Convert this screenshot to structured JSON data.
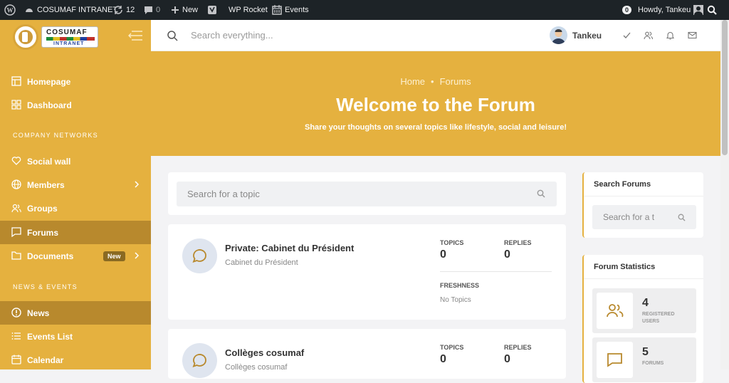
{
  "adminbar": {
    "site_name": "COSUMAF INTRANET",
    "updates_count": "12",
    "comments_count": "0",
    "new_label": "New",
    "rocket_label": "WP Rocket",
    "events_label": "Events",
    "notif_count": "0",
    "howdy": "Howdy, Tankeu"
  },
  "logo": {
    "line1": "COSUMAF",
    "line2": "INTRANET"
  },
  "sidebar": {
    "items": [
      {
        "label": "Homepage"
      },
      {
        "label": "Dashboard"
      },
      {
        "label": "Social wall"
      },
      {
        "label": "Members"
      },
      {
        "label": "Groups"
      },
      {
        "label": "Forums"
      },
      {
        "label": "Documents",
        "badge": "New"
      },
      {
        "label": "News"
      },
      {
        "label": "Events List"
      },
      {
        "label": "Calendar"
      }
    ],
    "section1": "COMPANY NETWORKS",
    "section2": "NEWS & EVENTS"
  },
  "topbar": {
    "search_placeholder": "Search everything...",
    "username": "Tankeu"
  },
  "hero": {
    "bc_home": "Home",
    "bc_sep": "•",
    "bc_current": "Forums",
    "title": "Welcome to the Forum",
    "subtitle": "Share your thoughts on several topics like lifestyle, social and leisure!"
  },
  "topic_search": {
    "placeholder": "Search for a topic"
  },
  "forums": [
    {
      "title": "Private: Cabinet du Président",
      "desc": "Cabinet du Président",
      "topics_label": "TOPICS",
      "topics": "0",
      "replies_label": "REPLIES",
      "replies": "0",
      "freshness_label": "FRESHNESS",
      "freshness": "No Topics"
    },
    {
      "title": "Collèges cosumaf",
      "desc": "Collèges cosumaf",
      "topics_label": "TOPICS",
      "topics": "0",
      "replies_label": "REPLIES",
      "replies": "0"
    }
  ],
  "side": {
    "search_title": "Search Forums",
    "search_placeholder": "Search for a t",
    "stats_title": "Forum Statistics",
    "stats": [
      {
        "num": "4",
        "label": "REGISTERED USERS"
      },
      {
        "num": "5",
        "label": "FORUMS"
      }
    ]
  },
  "colors": {
    "accent": "#e5b13f",
    "accent_dark": "#b8892d",
    "adminbar": "#1d2327"
  }
}
